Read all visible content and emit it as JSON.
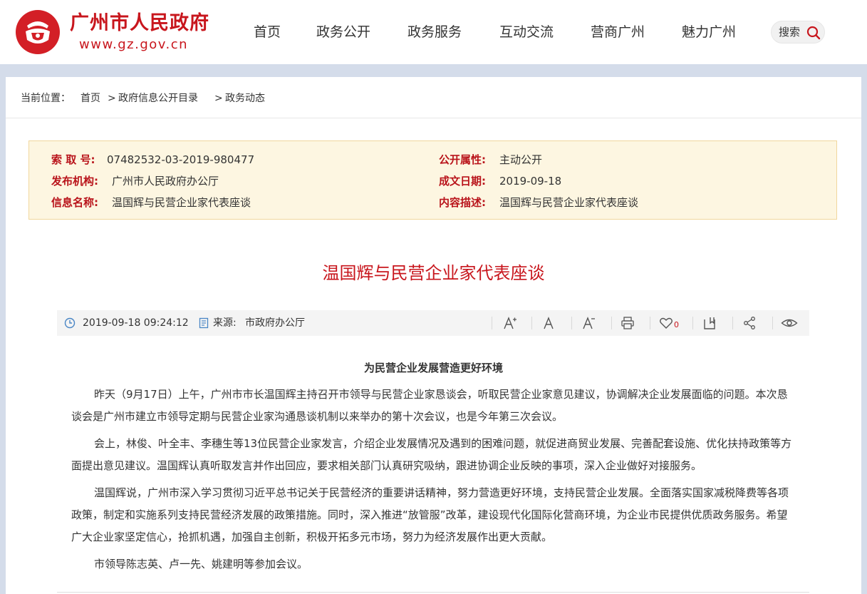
{
  "header": {
    "site_title": "广州市人民政府",
    "site_url": "www.gz.gov.cn",
    "nav": [
      "首页",
      "政务公开",
      "政务服务",
      "互动交流",
      "营商广州",
      "魅力广州"
    ],
    "search_label": "搜索"
  },
  "breadcrumb": {
    "prefix": "当前位置：",
    "items": [
      "首页",
      "政府信息公开目录",
      "政务动态"
    ],
    "separator": ">"
  },
  "meta": {
    "index_no_label": "索 取 号:",
    "index_no": "07482532-03-2019-980477",
    "publisher_label": "发布机构:",
    "publisher": "广州市人民政府办公厅",
    "info_name_label": "信息名称:",
    "info_name": "温国辉与民营企业家代表座谈",
    "attr_label": "公开属性:",
    "attr": "主动公开",
    "date_label": "成文日期:",
    "date": "2019-09-18",
    "desc_label": "内容描述:",
    "desc": "温国辉与民营企业家代表座谈"
  },
  "article": {
    "title": "温国辉与民营企业家代表座谈",
    "datetime": "2019-09-18 09:24:12",
    "source_label": "来源:",
    "source": "市政府办公厅",
    "like_count": "0",
    "subheading": "为民营企业发展营造更好环境",
    "paragraphs": [
      "昨天（9月17日）上午，广州市市长温国辉主持召开市领导与民营企业家恳谈会，听取民营企业家意见建议，协调解决企业发展面临的问题。本次恳谈会是广州市建立市领导定期与民营企业家沟通恳谈机制以来举办的第十次会议，也是今年第三次会议。",
      "会上，林俊、叶全丰、李穗生等13位民营企业家发言，介绍企业发展情况及遇到的困难问题，就促进商贸业发展、完善配套设施、优化扶持政策等方面提出意见建议。温国辉认真听取发言并作出回应，要求相关部门认真研究吸纳，跟进协调企业反映的事项，深入企业做好对接服务。",
      "温国辉说，广州市深入学习贯彻习近平总书记关于民营经济的重要讲话精神，努力营造更好环境，支持民营企业发展。全面落实国家减税降费等各项政策，制定和实施系列支持民营经济发展的政策措施。同时，深入推进“放管服”改革，建设现代化国际化营商环境，为企业市民提供优质政务服务。希望广大企业家坚定信心，抢抓机遇，加强自主创新，积极开拓多元市场，努力为经济发展作出更大贡献。",
      "市领导陈志英、卢一先、姚建明等参加会议。"
    ]
  },
  "colors": {
    "brand_red": "#c8161d",
    "meta_bg": "#fdf6e1"
  },
  "icons": [
    "emblem-logo",
    "search-icon",
    "clock-icon",
    "source-icon",
    "font-increase-icon",
    "font-reset-icon",
    "font-decrease-icon",
    "print-icon",
    "heart-icon",
    "bookmark-icon",
    "share-icon",
    "eye-icon"
  ]
}
